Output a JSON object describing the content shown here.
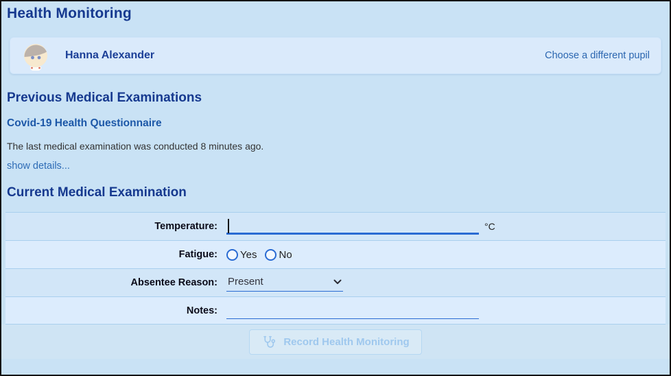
{
  "page": {
    "title": "Health Monitoring"
  },
  "pupil_card": {
    "name": "Hanna Alexander",
    "change_link": "Choose a different pupil",
    "avatar_icon": "pupil-avatar-icon"
  },
  "previous_exams": {
    "heading": "Previous Medical Examinations",
    "exam_title": "Covid-19 Health Questionnaire",
    "summary": "The last medical examination was conducted 8 minutes ago.",
    "details_link": "show details..."
  },
  "current_exam": {
    "heading": "Current Medical Examination",
    "fields": {
      "temperature": {
        "label": "Temperature:",
        "value": "",
        "unit": "°C"
      },
      "fatigue": {
        "label": "Fatigue:",
        "options": [
          "Yes",
          "No"
        ],
        "selected": ""
      },
      "absentee_reason": {
        "label": "Absentee Reason:",
        "selected_option": "Present"
      },
      "notes": {
        "label": "Notes:",
        "value": ""
      }
    },
    "submit": {
      "label": "Record Health Monitoring",
      "icon": "stethoscope-icon",
      "enabled": false
    }
  },
  "colors": {
    "page_bg": "#c9e2f5",
    "card_bg": "#daeafb",
    "row_odd_bg": "#d2e6f8",
    "row_even_bg": "#dcecfd",
    "row_divider": "#a9cfee",
    "heading_navy": "#16398f",
    "link_blue": "#2b66b0",
    "accent_blue": "#2a6bd3",
    "disabled_button_text": "#9fc8ee"
  }
}
